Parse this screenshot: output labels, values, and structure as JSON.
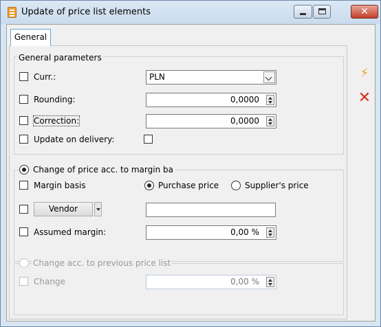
{
  "window": {
    "title": "Update of price list elements",
    "app_icon": "price-list-icon",
    "controls": {
      "minimize": "minimize-icon",
      "maximize": "maximize-icon",
      "close": "✕"
    }
  },
  "tabs": [
    {
      "label": "General",
      "selected": true
    }
  ],
  "general_parameters": {
    "legend": "General parameters",
    "currency": {
      "label": "Curr.:",
      "checked": false,
      "value": "PLN"
    },
    "rounding": {
      "label": "Rounding:",
      "checked": false,
      "value": "0,0000"
    },
    "correction": {
      "label": "Correction:",
      "checked": false,
      "value": "0,0000"
    },
    "update_on_delivery": {
      "label": "Update on delivery:",
      "checked": false,
      "value_checked": false
    }
  },
  "margin_group": {
    "legend": "Change of price acc. to margin ba",
    "selected": true,
    "margin_basis": {
      "label": "Margin basis",
      "checked": false
    },
    "basis_options": [
      {
        "label": "Purchase price",
        "selected": true
      },
      {
        "label": "Supplier's price",
        "selected": false
      }
    ],
    "vendor": {
      "button_label": "Vendor",
      "checked": false,
      "value": ""
    },
    "assumed_margin": {
      "label": "Assumed margin:",
      "checked": false,
      "value": "0,00 %"
    }
  },
  "previous_price_list": {
    "legend": "Change acc. to previous price list",
    "enabled": false,
    "change": {
      "label": "Change",
      "checked": false,
      "value": "0,00 %"
    }
  },
  "side_buttons": [
    {
      "name": "execute-icon",
      "glyph": "⚡"
    },
    {
      "name": "cancel-icon",
      "glyph": "✕"
    }
  ],
  "colors": {
    "title_bar": "#d6e4f3",
    "close_button": "#c3402b",
    "tab_border": "#5fa8d6"
  }
}
